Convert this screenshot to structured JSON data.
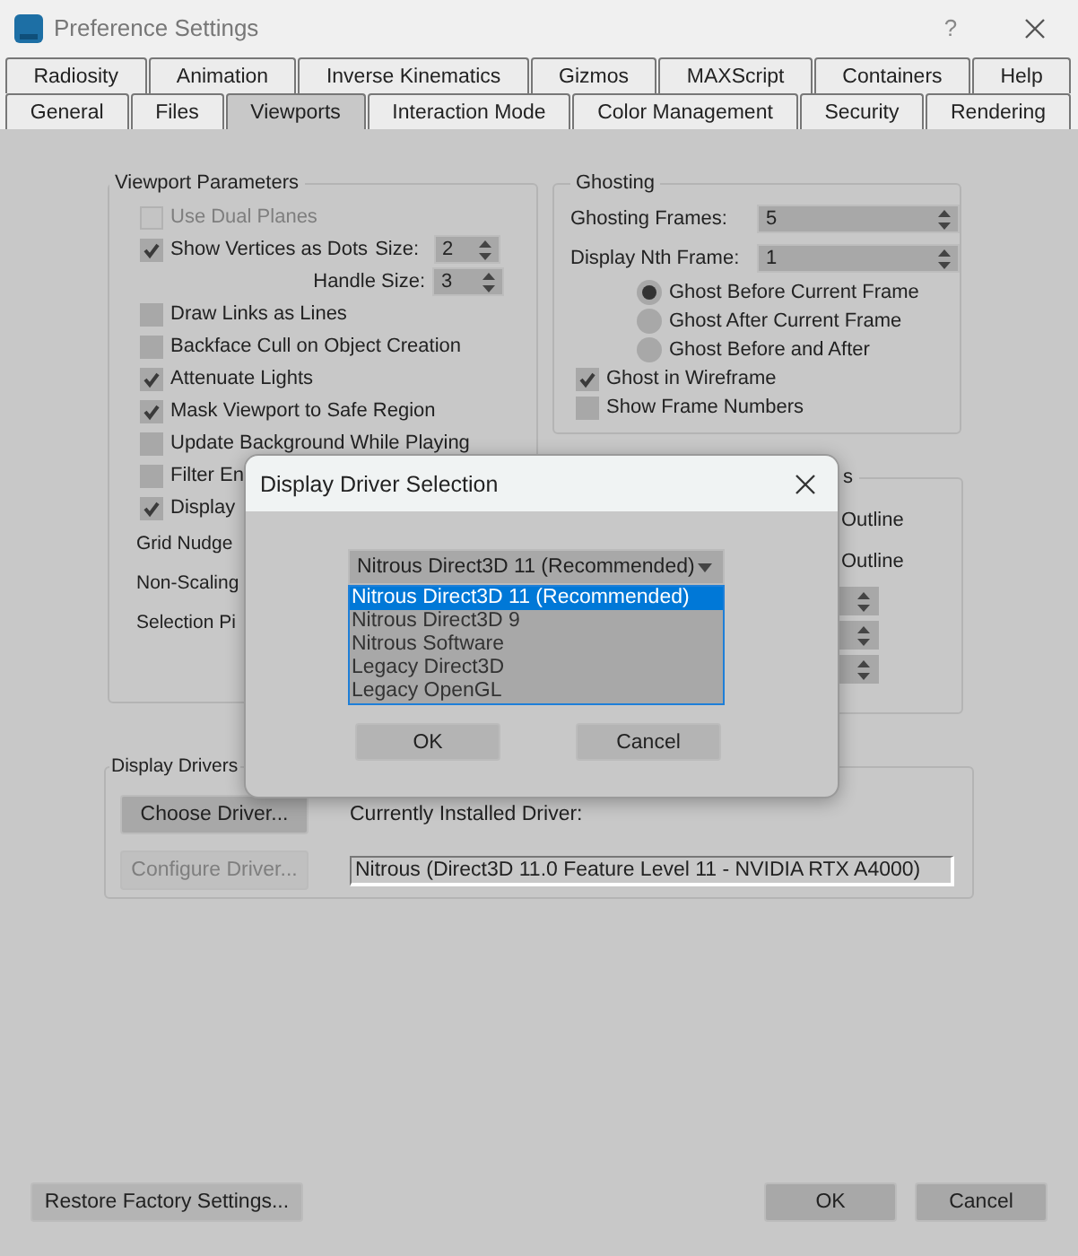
{
  "window": {
    "title": "Preference Settings",
    "help": "?"
  },
  "tab_rows": [
    [
      {
        "label": "Radiosity",
        "selected": false
      },
      {
        "label": "Animation",
        "selected": false
      },
      {
        "label": "Inverse Kinematics",
        "selected": false
      },
      {
        "label": "Gizmos",
        "selected": false
      },
      {
        "label": "MAXScript",
        "selected": false
      },
      {
        "label": "Containers",
        "selected": false
      },
      {
        "label": "Help",
        "selected": false
      }
    ],
    [
      {
        "label": "General",
        "selected": false
      },
      {
        "label": "Files",
        "selected": false
      },
      {
        "label": "Viewports",
        "selected": true
      },
      {
        "label": "Interaction Mode",
        "selected": false
      },
      {
        "label": "Color Management",
        "selected": false
      },
      {
        "label": "Security",
        "selected": false
      },
      {
        "label": "Rendering",
        "selected": false
      }
    ]
  ],
  "viewport_parameters": {
    "title": "Viewport Parameters",
    "items": [
      {
        "kind": "checkbox",
        "label": "Use Dual Planes",
        "checked": false,
        "disabled": true
      },
      {
        "kind": "checkbox",
        "label": "Show Vertices as Dots",
        "checked": true,
        "disabled": false,
        "spinner": {
          "label": "Size:",
          "value": "2"
        }
      },
      {
        "kind": "spinner",
        "label": "Handle Size:",
        "value": "3"
      },
      {
        "kind": "checkbox",
        "label": "Draw Links as Lines",
        "checked": false,
        "disabled": false
      },
      {
        "kind": "checkbox",
        "label": "Backface Cull on Object Creation",
        "checked": false,
        "disabled": false
      },
      {
        "kind": "checkbox",
        "label": "Attenuate Lights",
        "checked": true,
        "disabled": false
      },
      {
        "kind": "checkbox",
        "label": "Mask Viewport to Safe Region",
        "checked": true,
        "disabled": false
      },
      {
        "kind": "checkbox",
        "label": "Update Background While Playing",
        "checked": false,
        "disabled": false
      },
      {
        "kind": "checkbox",
        "label": "Filter En",
        "checked": false,
        "disabled": false
      },
      {
        "kind": "checkbox",
        "label": "Display",
        "checked": true,
        "disabled": false
      },
      {
        "kind": "label",
        "label": "Grid Nudge"
      },
      {
        "kind": "label",
        "label": "Non-Scaling"
      },
      {
        "kind": "label",
        "label": "Selection Pi"
      }
    ]
  },
  "ghosting": {
    "title": "Ghosting",
    "spinners": [
      {
        "label": "Ghosting Frames:",
        "value": "5"
      },
      {
        "label": "Display Nth Frame:",
        "value": "1"
      }
    ],
    "radios": [
      {
        "label": "Ghost Before Current Frame",
        "selected": true
      },
      {
        "label": "Ghost After Current Frame",
        "selected": false
      },
      {
        "label": "Ghost Before and After",
        "selected": false
      }
    ],
    "checkboxes": [
      {
        "label": "Ghost in Wireframe",
        "checked": true
      },
      {
        "label": "Show Frame Numbers",
        "checked": false
      }
    ]
  },
  "hidden_group": {
    "title": "s",
    "items": [
      {
        "kind": "label",
        "label": "Outline"
      },
      {
        "kind": "label",
        "label": "Outline"
      },
      {
        "kind": "spinner"
      },
      {
        "kind": "spinner"
      },
      {
        "kind": "spinner"
      }
    ]
  },
  "display_drivers": {
    "title": "Display Drivers",
    "buttons": [
      {
        "label": "Choose Driver...",
        "disabled": false
      },
      {
        "label": "Configure Driver...",
        "disabled": true
      }
    ],
    "installed_label": "Currently Installed Driver:",
    "installed_value": "Nitrous (Direct3D 11.0 Feature Level 11 - NVIDIA RTX A4000)"
  },
  "footer": {
    "restore": "Restore Factory Settings...",
    "buttons": [
      "OK",
      "Cancel"
    ]
  },
  "dialog": {
    "title": "Display Driver Selection",
    "dropdown": {
      "value": "Nitrous Direct3D 11 (Recommended)",
      "options": [
        {
          "label": "Nitrous Direct3D 11 (Recommended)",
          "selected": true
        },
        {
          "label": "Nitrous Direct3D 9",
          "selected": false
        },
        {
          "label": "Nitrous Software",
          "selected": false
        },
        {
          "label": "Legacy Direct3D",
          "selected": false
        },
        {
          "label": "Legacy OpenGL",
          "selected": false
        }
      ]
    },
    "buttons": [
      "OK",
      "Cancel"
    ]
  }
}
